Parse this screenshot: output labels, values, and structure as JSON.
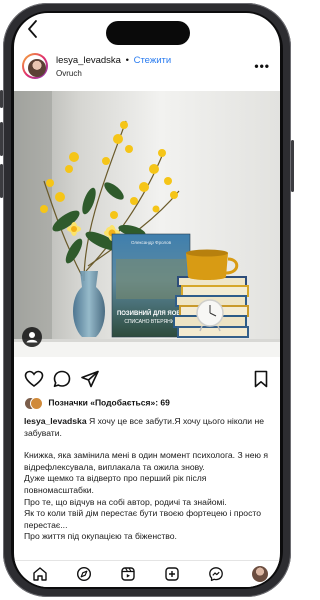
{
  "post": {
    "username": "lesya_levadska",
    "separator": "•",
    "follow_label": "Стежити",
    "location": "Ovruch",
    "more_label": "•••"
  },
  "photo": {
    "book_author": "Олександр Фролов",
    "book_title_line1": "ПОЗИВНИЙ ДЛЯ ЯОВИ",
    "book_title_line2": "СПИСАНО ВТЕРЯНИХ"
  },
  "likes": {
    "text": "Позначки «Подобається»: 69"
  },
  "caption": {
    "username": "lesya_levadska",
    "lines": [
      "Я хочу це все забути.Я хочу цього ніколи не забувати.",
      "",
      "Книжка, яка замінила мені в один момент психолога. З нею я відрефлексувала, виплакала та ожила знову.",
      "Дуже щемко та відверто про перший рік після повномасштабки.",
      "Про те, що відчув на собі автор, родичі та знайомі.",
      "Як то коли твій дім перестає бути твоєю фортецею і просто перестає...",
      "Про життя під окупацією та біженство."
    ]
  },
  "colors": {
    "accent": "#2a7cf0",
    "frame": "#2d2d31"
  },
  "icons": {
    "back": "chevron-left-icon",
    "heart": "heart-icon",
    "comment": "comment-icon",
    "share": "send-icon",
    "save": "bookmark-icon",
    "user": "user-icon",
    "home": "home-icon",
    "explore": "compass-icon",
    "reels": "reels-icon",
    "create": "plus-square-icon",
    "messages": "messenger-icon",
    "profile": "profile-avatar-icon"
  }
}
